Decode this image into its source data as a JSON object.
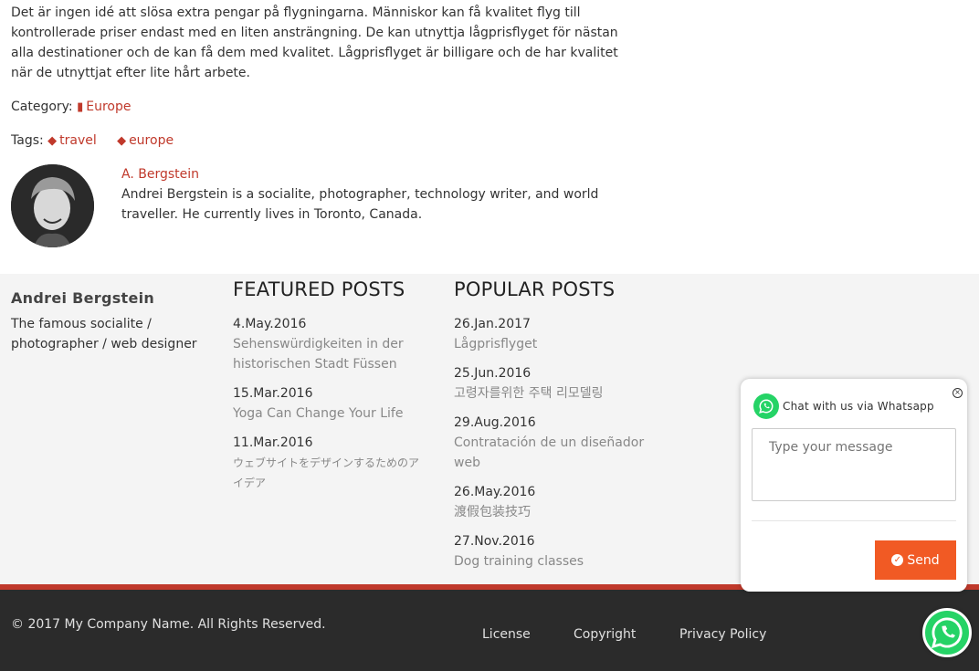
{
  "article": {
    "body": "Det är ingen idé att slösa extra pengar på flygningarna. Människor kan få kvalitet flyg till kontrollerade priser endast med en liten ansträngning. De kan utnyttja lågprisflyget för nästan alla destinationer och de kan få dem med kvalitet. Lågprisflyget är billigare och de har kvalitet när de utnyttjat efter lite hårt arbete.",
    "category_label": "Category:",
    "category": "Europe",
    "tags_label": "Tags:",
    "tags": [
      "travel",
      "europe"
    ]
  },
  "author": {
    "name": "A. Bergstein",
    "bio": "Andrei Bergstein is a socialite, photographer, technology writer, and world traveller. He currently lives in Toronto, Canada."
  },
  "footer": {
    "brand": "Andrei Bergstein",
    "tagline": "The famous socialite / photographer / web designer",
    "featured_heading": "FEATURED POSTS",
    "featured": [
      {
        "date": "4.May.2016",
        "title": "Sehenswürdigkeiten in der historischen Stadt Füssen"
      },
      {
        "date": "15.Mar.2016",
        "title": "Yoga Can Change Your Life"
      },
      {
        "date": "11.Mar.2016",
        "title": "ウェブサイトをデザインするためのアイデア"
      }
    ],
    "popular_heading": "POPULAR POSTS",
    "popular": [
      {
        "date": "26.Jan.2017",
        "title": "Lågprisflyget"
      },
      {
        "date": "25.Jun.2016",
        "title": "고령자를위한 주택 리모델링"
      },
      {
        "date": "29.Aug.2016",
        "title": "Contratación de un diseñador web"
      },
      {
        "date": "26.May.2016",
        "title": "渡假包装技巧"
      },
      {
        "date": "27.Nov.2016",
        "title": "Dog training classes"
      }
    ],
    "copyright": "© 2017 My Company Name. All Rights Reserved.",
    "links": [
      "License",
      "Copyright",
      "Privacy Policy"
    ]
  },
  "chat": {
    "title": "Chat with us via Whatsapp",
    "placeholder": "Type your message",
    "send_label": "Send"
  },
  "colors": {
    "accent": "#c0392b",
    "send": "#f15a24",
    "whatsapp": "#25d366"
  }
}
